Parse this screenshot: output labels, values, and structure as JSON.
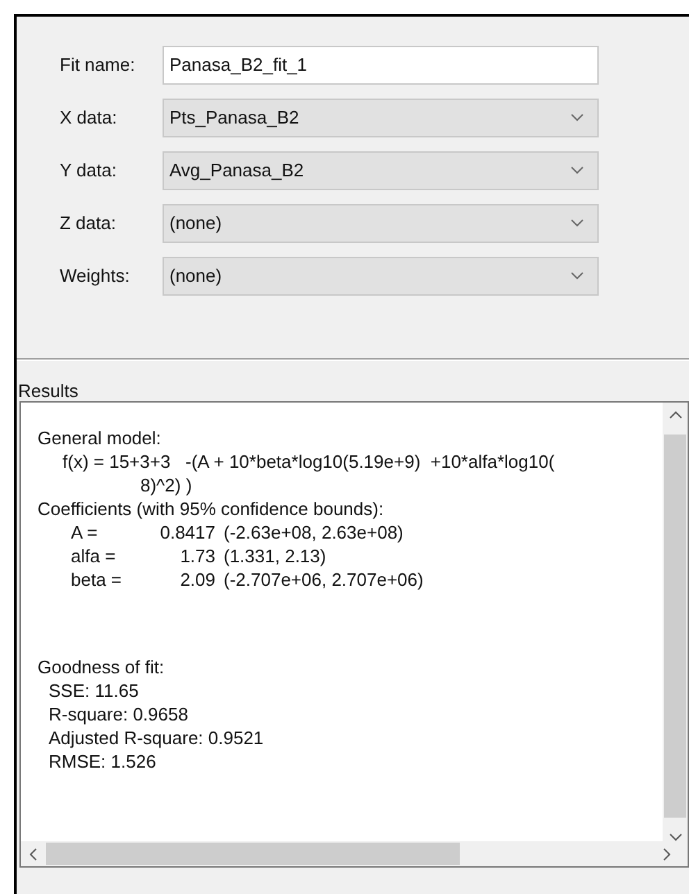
{
  "fields": [
    {
      "kind": "text",
      "label": "Fit name:",
      "value": "Panasa_B2_fit_1"
    },
    {
      "kind": "select",
      "label": "X data:",
      "value": "Pts_Panasa_B2"
    },
    {
      "kind": "select",
      "label": "Y data:",
      "value": "Avg_Panasa_B2"
    },
    {
      "kind": "select",
      "label": "Z data:",
      "value": "(none)"
    },
    {
      "kind": "select",
      "label": "Weights:",
      "value": "(none)"
    }
  ],
  "results": {
    "title": "Results",
    "general_model": {
      "heading": "General model:",
      "formula": "f(x) = 15+3+3   -(A + 10*beta*log10(5.19e+9)  +10*alfa*log10(",
      "continuation": "8)^2) )"
    },
    "coefficients": {
      "heading": "Coefficients (with 95% confidence bounds):",
      "rows": [
        {
          "name": "A =",
          "value": "0.8417",
          "bounds": "(-2.63e+08, 2.63e+08)"
        },
        {
          "name": "alfa =",
          "value": "1.73",
          "bounds": "(1.331, 2.13)"
        },
        {
          "name": "beta =",
          "value": "2.09",
          "bounds": "(-2.707e+06, 2.707e+06)"
        }
      ]
    },
    "goodness": {
      "heading": "Goodness of fit:",
      "lines": [
        "SSE: 11.65",
        "R-square: 0.9658",
        "Adjusted R-square: 0.9521",
        "RMSE: 1.526"
      ]
    }
  }
}
